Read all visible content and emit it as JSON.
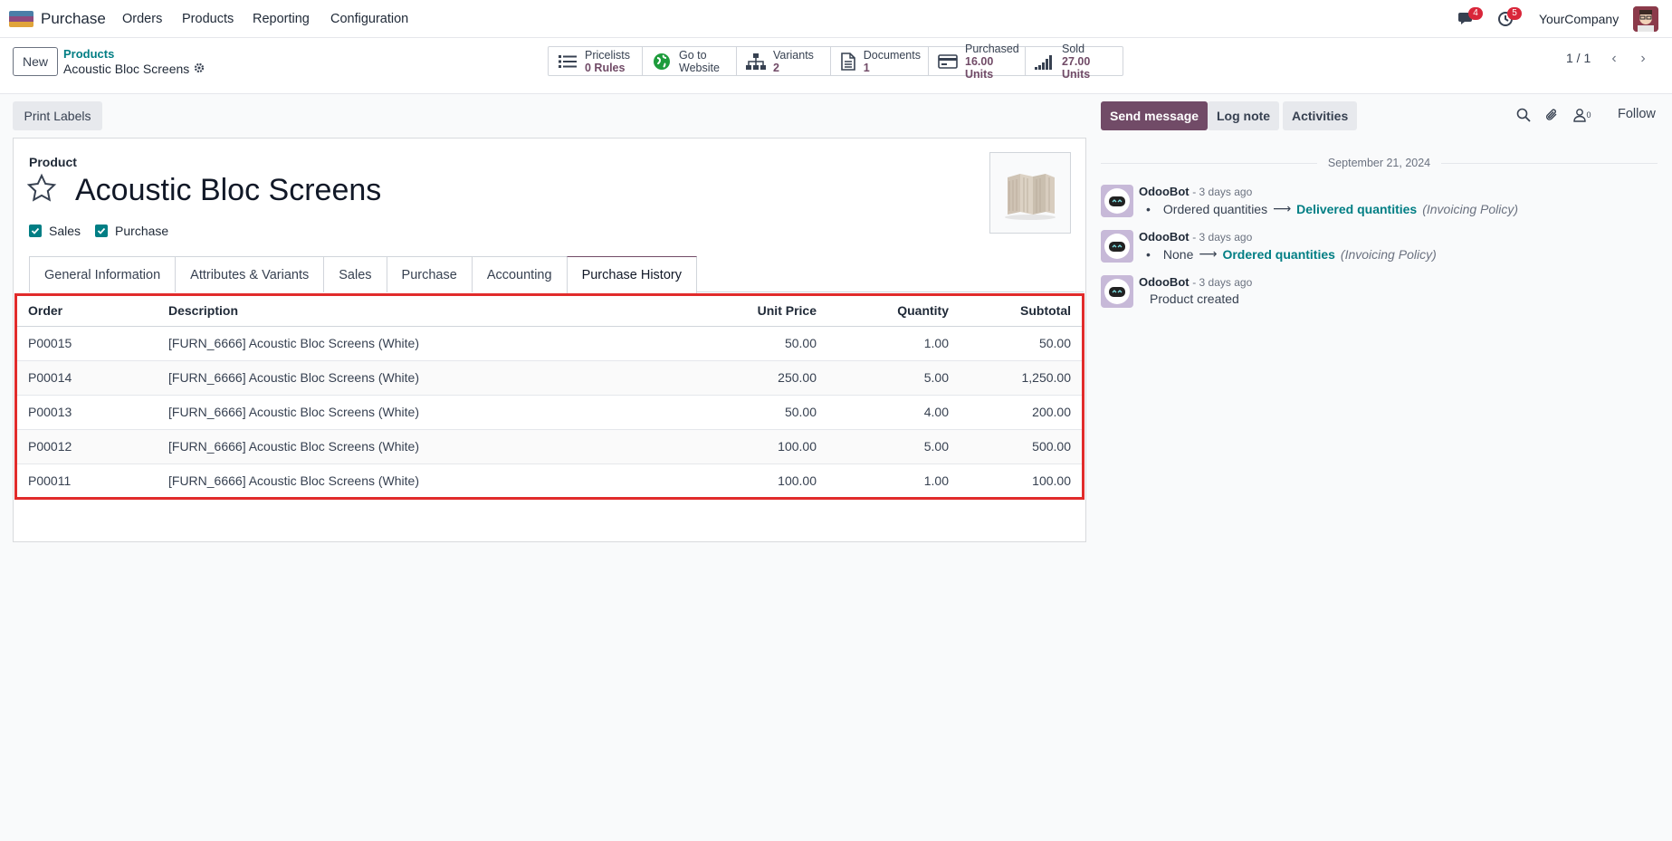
{
  "nav": {
    "app_name": "Purchase",
    "menu": [
      "Orders",
      "Products",
      "Reporting",
      "Configuration"
    ],
    "messages_badge": "4",
    "activities_badge": "5",
    "company": "YourCompany"
  },
  "control": {
    "new_label": "New",
    "breadcrumb_parent": "Products",
    "breadcrumb_current": "Acoustic Bloc Screens",
    "smart_buttons": [
      {
        "label": "Pricelists",
        "value": "0 Rules",
        "icon": "list-icon"
      },
      {
        "label": "Go to",
        "value": "Website",
        "icon": "globe-icon"
      },
      {
        "label": "Variants",
        "value": "2",
        "icon": "sitemap-icon"
      },
      {
        "label": "Documents",
        "value": "1",
        "icon": "document-icon"
      },
      {
        "label": "Purchased",
        "value": "16.00 Units",
        "icon": "credit-card-icon"
      },
      {
        "label": "Sold",
        "value": "27.00 Units",
        "icon": "signal-icon"
      }
    ],
    "pager": "1 / 1"
  },
  "form": {
    "print_labels": "Print Labels",
    "product_label": "Product",
    "product_name": "Acoustic Bloc Screens",
    "sales_check": "Sales",
    "purchase_check": "Purchase",
    "tabs": [
      "General Information",
      "Attributes & Variants",
      "Sales",
      "Purchase",
      "Accounting",
      "Purchase History"
    ],
    "active_tab": "Purchase History",
    "history": {
      "headers": [
        "Order",
        "Description",
        "Unit Price",
        "Quantity",
        "Subtotal"
      ],
      "rows": [
        [
          "P00015",
          "[FURN_6666] Acoustic Bloc Screens (White)",
          "50.00",
          "1.00",
          "50.00"
        ],
        [
          "P00014",
          "[FURN_6666] Acoustic Bloc Screens (White)",
          "250.00",
          "5.00",
          "1,250.00"
        ],
        [
          "P00013",
          "[FURN_6666] Acoustic Bloc Screens (White)",
          "50.00",
          "4.00",
          "200.00"
        ],
        [
          "P00012",
          "[FURN_6666] Acoustic Bloc Screens (White)",
          "100.00",
          "5.00",
          "500.00"
        ],
        [
          "P00011",
          "[FURN_6666] Acoustic Bloc Screens (White)",
          "100.00",
          "1.00",
          "100.00"
        ]
      ]
    }
  },
  "chatter": {
    "send_message": "Send message",
    "log_note": "Log note",
    "activities": "Activities",
    "followers_count": "0",
    "follow": "Follow",
    "date": "September 21, 2024",
    "messages": [
      {
        "author": "OdooBot",
        "time": "- 3 days ago",
        "bullet": true,
        "old": "Ordered quantities",
        "new": "Delivered quantities",
        "field": "(Invoicing Policy)"
      },
      {
        "author": "OdooBot",
        "time": "- 3 days ago",
        "bullet": true,
        "old": "None",
        "new": "Ordered quantities",
        "field": "(Invoicing Policy)"
      },
      {
        "author": "OdooBot",
        "time": "- 3 days ago",
        "bullet": false,
        "text": "Product created"
      }
    ]
  },
  "colors": {
    "brand": "#714b67",
    "teal": "#017e84",
    "highlight": "#e12b2b",
    "badge": "#d9263a"
  }
}
